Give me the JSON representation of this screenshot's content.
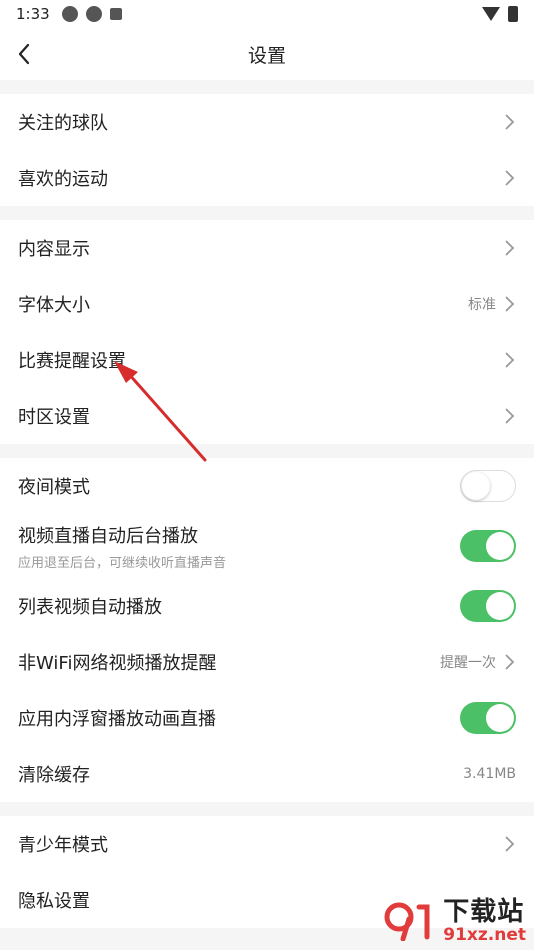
{
  "status_bar": {
    "time": "1:33"
  },
  "navbar": {
    "title": "设置"
  },
  "groups": [
    {
      "items": [
        {
          "label": "关注的球队"
        },
        {
          "label": "喜欢的运动"
        }
      ]
    },
    {
      "items": [
        {
          "label": "内容显示"
        },
        {
          "label": "字体大小",
          "value": "标准"
        },
        {
          "label": "比赛提醒设置"
        },
        {
          "label": "时区设置"
        }
      ]
    },
    {
      "items": [
        {
          "label": "夜间模式",
          "toggle": "off"
        },
        {
          "label": "视频直播自动后台播放",
          "sub": "应用退至后台，可继续收听直播声音",
          "toggle": "on"
        },
        {
          "label": "列表视频自动播放",
          "toggle": "on"
        },
        {
          "label": "非WiFi网络视频播放提醒",
          "value": "提醒一次"
        },
        {
          "label": "应用内浮窗播放动画直播",
          "toggle": "on"
        },
        {
          "label": "清除缓存",
          "value": "3.41MB"
        }
      ]
    },
    {
      "items": [
        {
          "label": "青少年模式"
        },
        {
          "label": "隐私设置"
        }
      ]
    }
  ],
  "watermark": {
    "brand": "下载站",
    "url": "91xz.net"
  },
  "colors": {
    "toggle_on": "#4cc066",
    "annotation_arrow": "#d62c2c"
  }
}
